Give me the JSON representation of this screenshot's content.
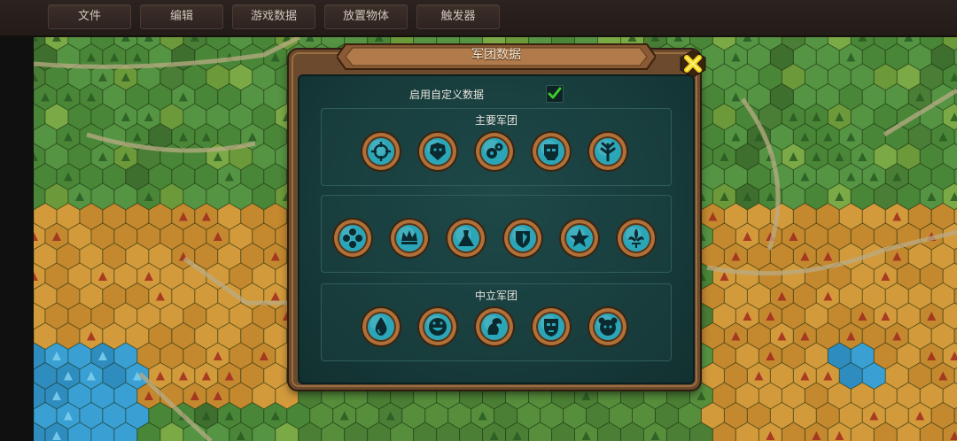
{
  "toolbar": {
    "menus": [
      "文件",
      "编辑",
      "游戏数据",
      "放置物体",
      "触发器"
    ]
  },
  "dialog": {
    "title": "军团数据",
    "custom_toggle_label": "启用自定义数据",
    "custom_enabled": true,
    "sections": {
      "major": {
        "title": "主要军团"
      },
      "middle": {
        "title": ""
      },
      "neutral": {
        "title": "中立军团"
      }
    },
    "major_emblems": [
      "crosshair-icon",
      "lion-icon",
      "gears-icon",
      "skull-mask-icon",
      "wheat-icon"
    ],
    "middle_emblems": [
      "flower-icon",
      "crown-icon",
      "dress-icon",
      "shield-icon",
      "star-burst-icon",
      "fleur-de-lis-icon"
    ],
    "neutral_emblems": [
      "water-drop-icon",
      "grin-face-icon",
      "dragon-icon",
      "tribal-mask-icon",
      "beast-face-icon"
    ]
  },
  "colors": {
    "panel_bg": "#163838",
    "frame": "#6b4a2d",
    "emblem_ring": "#b0703a",
    "emblem_core": "#2aa6b8",
    "check": "#3ccc2a",
    "close": "#f2d21a"
  }
}
